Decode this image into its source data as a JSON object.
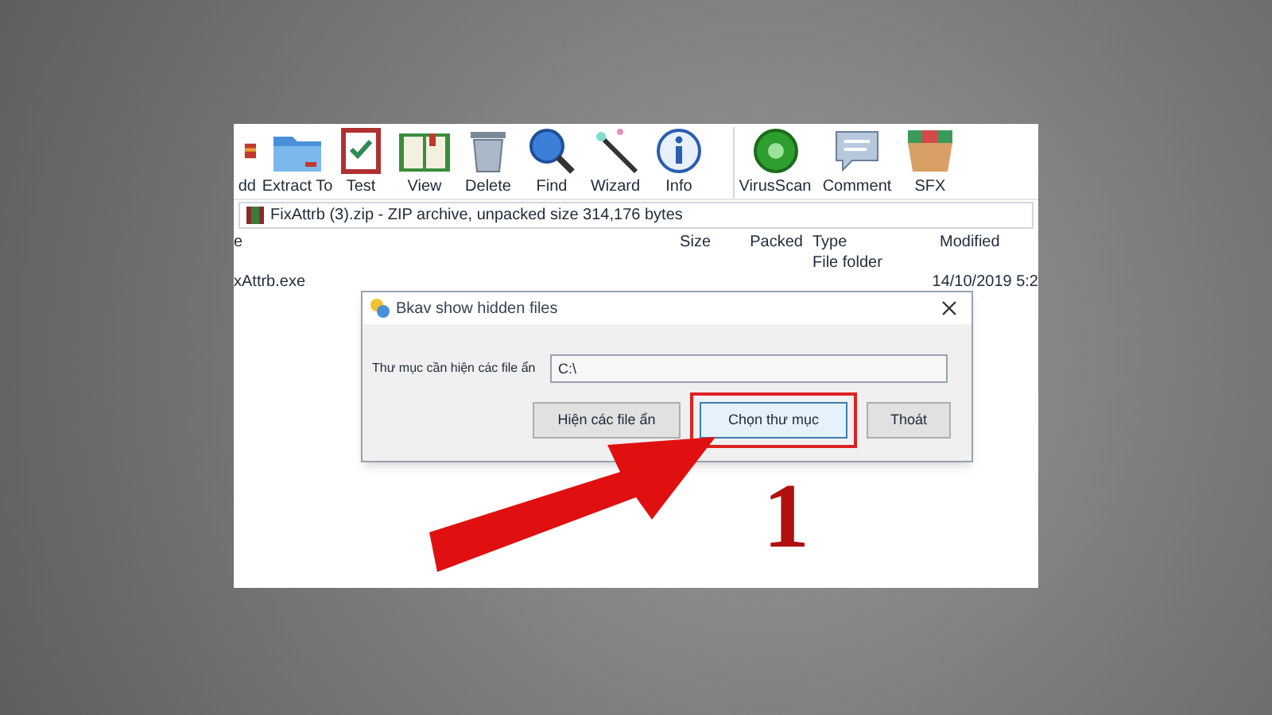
{
  "toolbar": [
    {
      "kind": "add",
      "label": "dd"
    },
    {
      "kind": "extract",
      "label": "Extract To"
    },
    {
      "kind": "test",
      "label": "Test"
    },
    {
      "kind": "view",
      "label": "View"
    },
    {
      "kind": "delete",
      "label": "Delete"
    },
    {
      "kind": "find",
      "label": "Find"
    },
    {
      "kind": "wizard",
      "label": "Wizard"
    },
    {
      "kind": "info",
      "label": "Info"
    },
    {
      "kind": "virus",
      "label": "VirusScan"
    },
    {
      "kind": "comment",
      "label": "Comment"
    },
    {
      "kind": "sfx",
      "label": "SFX"
    }
  ],
  "address": "FixAttrb (3).zip - ZIP archive, unpacked size 314,176 bytes",
  "columns": [
    "e",
    "Size",
    "Packed",
    "Type",
    "Modified"
  ],
  "rows": [
    {
      "name": "",
      "type": "File folder",
      "modified": ""
    },
    {
      "name": "xAttrb.exe",
      "type": "",
      "modified": "14/10/2019 5:2"
    }
  ],
  "dialog": {
    "title": "Bkav show hidden files",
    "label": "Thư mục cần hiện các file ẩn",
    "value": "C:\\",
    "buttons": [
      {
        "label": "Hiện các file ẩn",
        "selected": false
      },
      {
        "label": "Chọn thư mục",
        "selected": true
      },
      {
        "label": "Thoát",
        "selected": false
      }
    ]
  },
  "step": "1"
}
